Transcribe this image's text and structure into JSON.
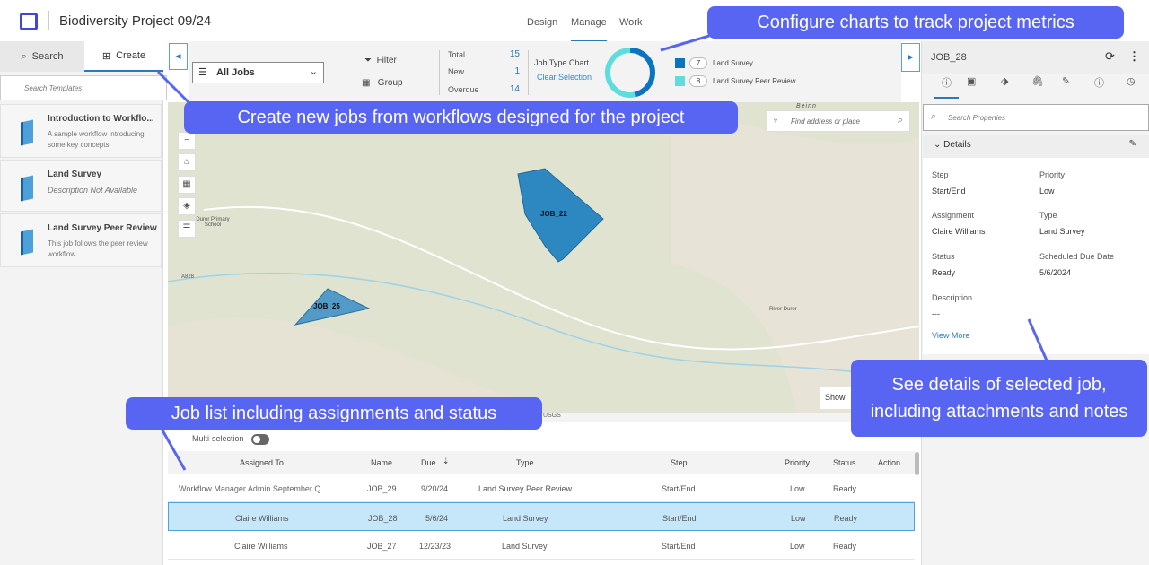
{
  "header": {
    "title": "Biodiversity Project 09/24",
    "nav": [
      "Design",
      "Manage",
      "Work"
    ]
  },
  "left_panel": {
    "tabs": [
      "Search",
      "Create"
    ],
    "search_placeholder": "Search Templates",
    "templates": [
      {
        "title": "Introduction to Workflo...",
        "desc": "A sample workflow introducing some key concepts"
      },
      {
        "title": "Land Survey",
        "desc": "Description Not Available"
      },
      {
        "title": "Land Survey Peer Review",
        "desc": "This job follows the peer review workflow."
      }
    ]
  },
  "toolbar": {
    "query": "All Jobs",
    "filter": "Filter",
    "group": "Group",
    "stats": [
      {
        "label": "Total",
        "value": "15"
      },
      {
        "label": "New",
        "value": "1"
      },
      {
        "label": "Overdue",
        "value": "14"
      }
    ],
    "chart_title": "Job Type Chart",
    "clear": "Clear Selection",
    "legend": [
      {
        "count": "7",
        "label": "Land Survey",
        "color": "#0a74c0"
      },
      {
        "count": "8",
        "label": "Land Survey Peer Review",
        "color": "#5fdcdc"
      }
    ]
  },
  "map": {
    "search_placeholder": "Find address or place",
    "jobs": [
      "JOB_22",
      "JOB_25"
    ],
    "labels": [
      "Duror Primary School",
      "A828",
      "Beinn",
      "River Duror",
      "Show",
      "USGS"
    ]
  },
  "job_list": {
    "multi": "Multi-selection",
    "columns": [
      "Assigned To",
      "Name",
      "Due",
      "Type",
      "Step",
      "Priority",
      "Status",
      "Action"
    ],
    "rows": [
      {
        "assigned": "Workflow Manager Admin September Q...",
        "name": "JOB_29",
        "due": "9/20/24",
        "type": "Land Survey Peer Review",
        "step": "Start/End",
        "priority": "Low",
        "status": "Ready"
      },
      {
        "assigned": "Claire Williams",
        "name": "JOB_28",
        "due": "5/6/24",
        "type": "Land Survey",
        "step": "Start/End",
        "priority": "Low",
        "status": "Ready"
      },
      {
        "assigned": "Claire Williams",
        "name": "JOB_27",
        "due": "12/23/23",
        "type": "Land Survey",
        "step": "Start/End",
        "priority": "Low",
        "status": "Ready"
      }
    ]
  },
  "details": {
    "job": "JOB_28",
    "search_placeholder": "Search Properties",
    "section": "Details",
    "fields": [
      {
        "label": "Step",
        "value": "Start/End"
      },
      {
        "label": "Priority",
        "value": "Low"
      },
      {
        "label": "Assignment",
        "value": "Claire Williams"
      },
      {
        "label": "Type",
        "value": "Land Survey"
      },
      {
        "label": "Status",
        "value": "Ready"
      },
      {
        "label": "Scheduled Due Date",
        "value": "5/6/2024"
      }
    ],
    "description_label": "Description",
    "description": "---",
    "view_more": "View More"
  },
  "callouts": [
    "Configure charts to track project metrics",
    "Create new jobs from workflows designed for the project",
    "Job list including assignments and status",
    "See details of selected job, including attachments and notes"
  ]
}
